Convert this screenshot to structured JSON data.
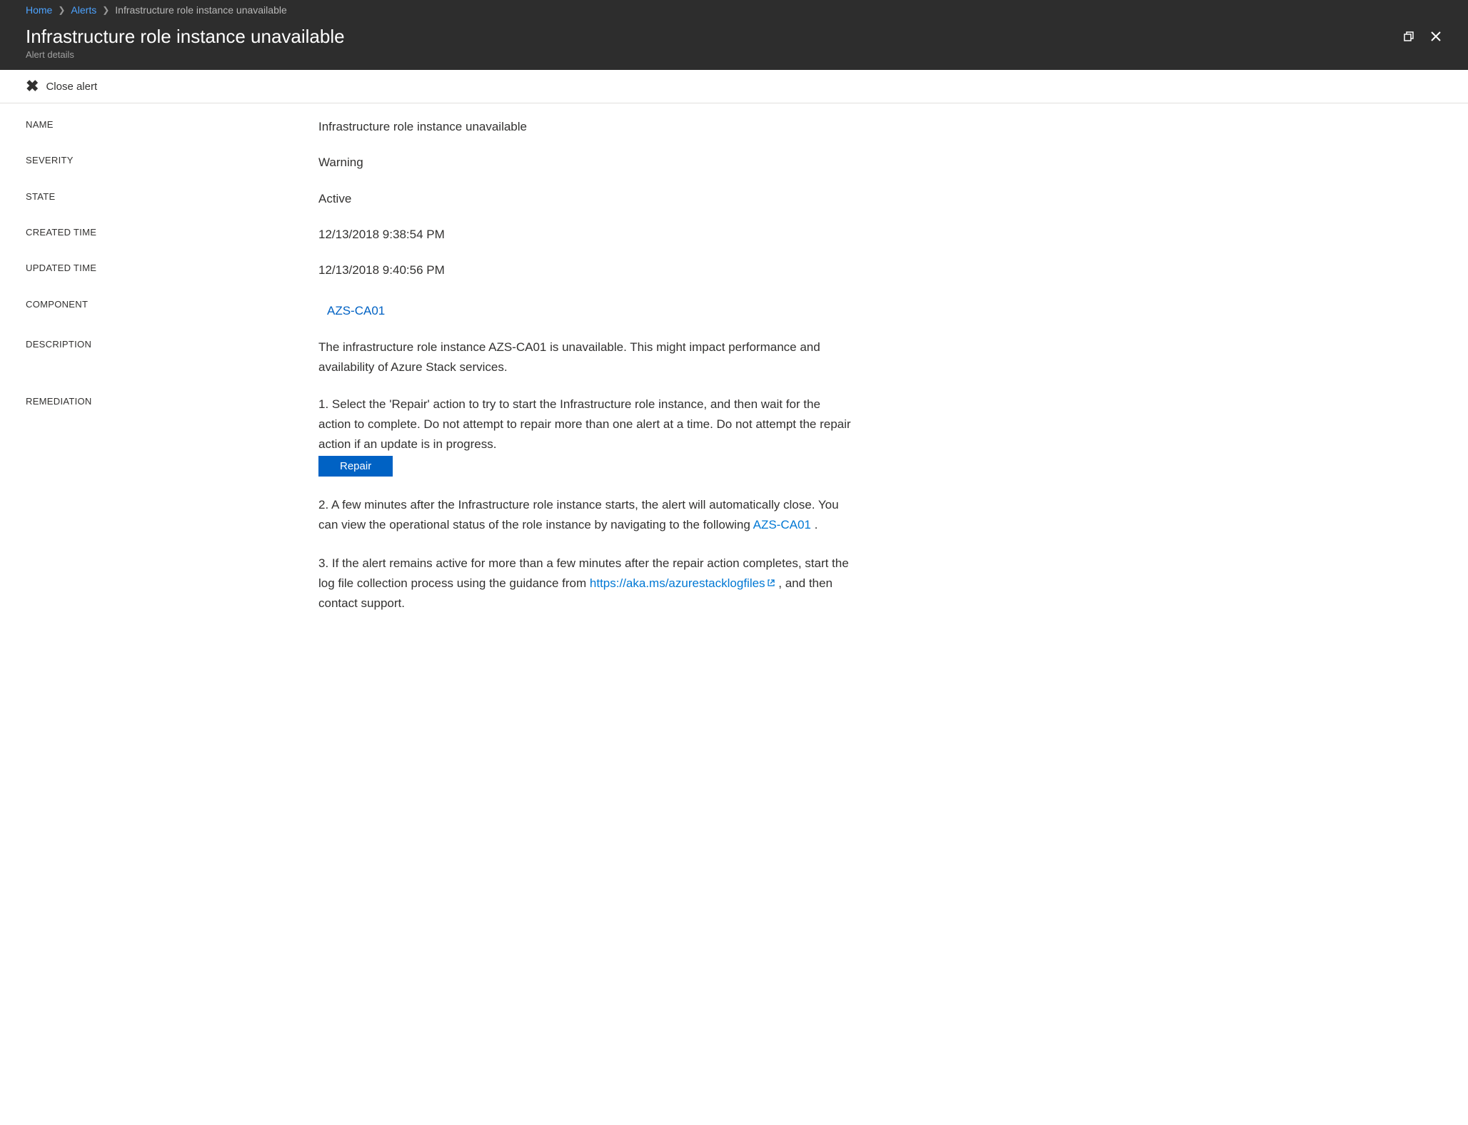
{
  "breadcrumb": {
    "home": "Home",
    "alerts": "Alerts",
    "current": "Infrastructure role instance unavailable"
  },
  "header": {
    "title": "Infrastructure role instance unavailable",
    "subtitle": "Alert details"
  },
  "commandBar": {
    "closeAlert": "Close alert"
  },
  "labels": {
    "name": "NAME",
    "severity": "SEVERITY",
    "state": "STATE",
    "createdTime": "CREATED TIME",
    "updatedTime": "UPDATED TIME",
    "component": "COMPONENT",
    "description": "DESCRIPTION",
    "remediation": "REMEDIATION"
  },
  "values": {
    "name": "Infrastructure role instance unavailable",
    "severity": "Warning",
    "state": "Active",
    "createdTime": "12/13/2018 9:38:54 PM",
    "updatedTime": "12/13/2018 9:40:56 PM",
    "component": "AZS-CA01",
    "description": "The infrastructure role instance AZS-CA01 is unavailable. This might impact performance and availability of Azure Stack services."
  },
  "remediation": {
    "step1": "1. Select the 'Repair' action to try to start the Infrastructure role instance, and then wait for the action to complete. Do not attempt to repair more than one alert at a time. Do not attempt the repair action if an update is in progress.",
    "repairButton": "Repair",
    "step2a": "2. A few minutes after the Infrastructure role instance starts, the alert will automatically close. You can view the operational status of the role instance by navigating to the following ",
    "step2link": "AZS-CA01",
    "step2b": " .",
    "step3a": "3. If the alert remains active for more than a few minutes after the repair action completes, start the log file collection process using the guidance from ",
    "step3link": "https://aka.ms/azurestacklogfiles",
    "step3b": " , and then contact support."
  }
}
